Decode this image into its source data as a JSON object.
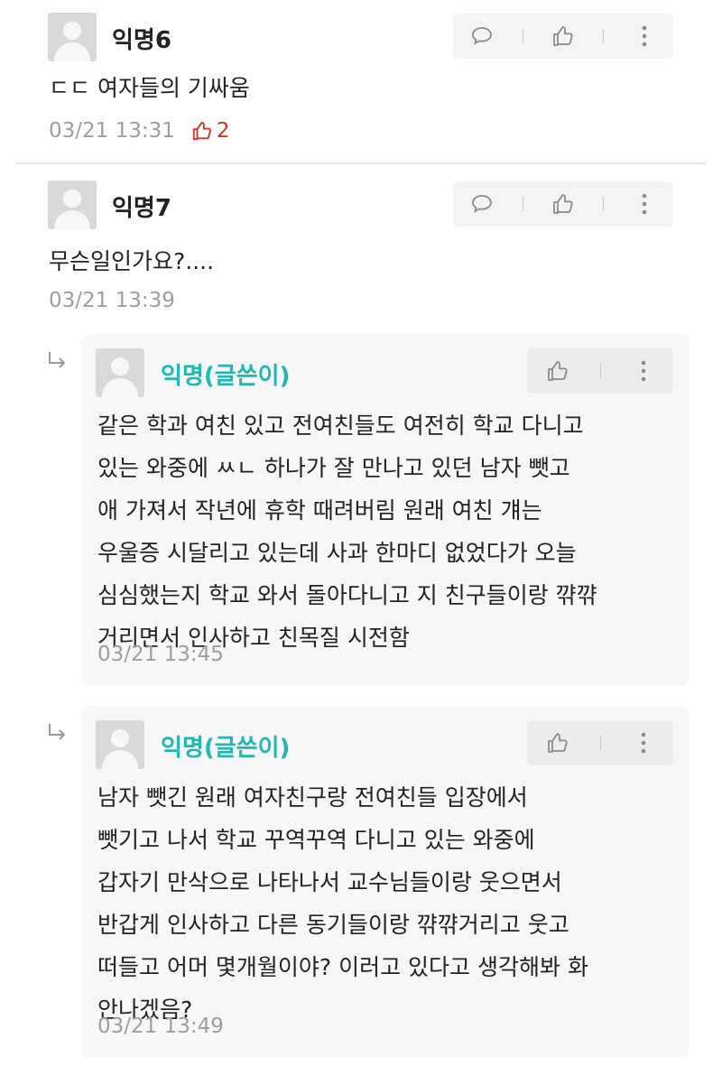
{
  "comments": [
    {
      "name": "익명6",
      "text": "ㄷㄷ 여자들의 기싸움",
      "time": "03/21 13:31",
      "likes": "2"
    },
    {
      "name": "익명7",
      "text": "무슨일인가요?....",
      "time": "03/21 13:39"
    }
  ],
  "replies": [
    {
      "name": "익명(글쓴이)",
      "lines": [
        "같은 학과 여친 있고 전여친들도 여전히 학교 다니고",
        "있는 와중에 ㅆㄴ 하나가 잘 만나고 있던 남자 뺏고",
        "애 가져서 작년에 휴학 때려버림 원래 여친 걔는",
        "우울증 시달리고 있는데 사과 한마디 없었다가 오늘",
        "심심했는지 학교 와서 돌아다니고 지 친구들이랑 꺆꺆",
        "거리면서 인사하고 친목질 시전함"
      ],
      "time": "03/21 13:45"
    },
    {
      "name": "익명(글쓴이)",
      "lines": [
        "남자 뺏긴 원래 여자친구랑 전여친들 입장에서",
        "뺏기고 나서 학교 꾸역꾸역 다니고 있는 와중에",
        "갑자기 만삭으로 나타나서 교수님들이랑 웃으면서",
        "반갑게 인사하고 다른 동기들이랑 꺆꺆거리고 웃고",
        "떠들고 어머 몇개월이야? 이러고 있다고 생각해봐 화",
        "안나겠음?"
      ],
      "time": "03/21 13:49"
    }
  ],
  "icons": {
    "comment": "comment-icon",
    "like": "thumbs-up-icon",
    "more": "more-vertical-icon",
    "reply": "reply-arrow-icon"
  },
  "colors": {
    "author": "#1fb8b3",
    "like_active": "#d93025",
    "meta": "#9e9e9e"
  }
}
